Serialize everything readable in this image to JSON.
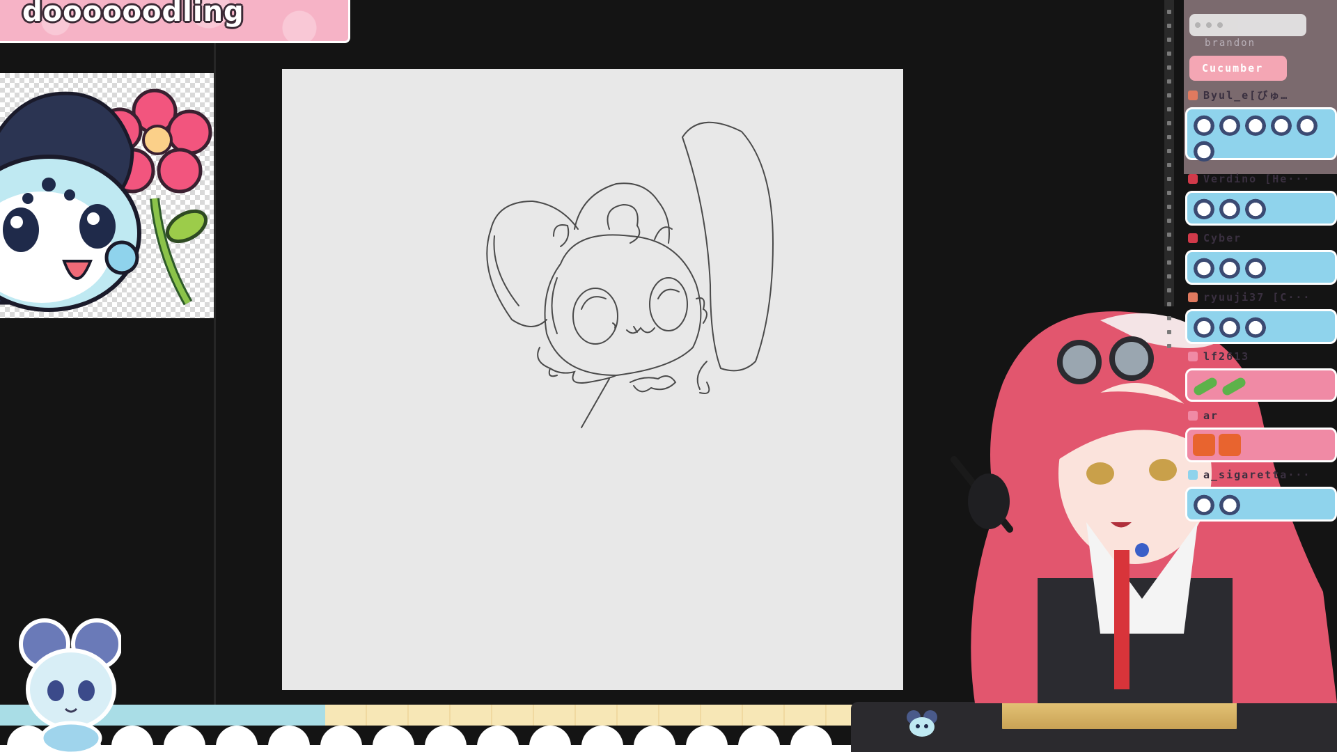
{
  "banner": {
    "title": "doooooodling"
  },
  "chat": {
    "top_username": "brandon",
    "top_pill": "Cucumber",
    "messages": [
      {
        "username": "Byul_e[びゅ…",
        "badge_color": "#e07a5f",
        "style": "blue",
        "emotes": [
          "panda",
          "panda",
          "panda",
          "panda",
          "panda",
          "panda"
        ]
      },
      {
        "username": "Verdino [He···",
        "badge_color": "#d13a4a",
        "style": "blue",
        "emotes": [
          "panda",
          "panda",
          "panda"
        ]
      },
      {
        "username": "Cyber",
        "badge_color": "#d13a4a",
        "style": "blue",
        "emotes": [
          "panda",
          "panda",
          "panda"
        ]
      },
      {
        "username": "ryuuji37 [C···",
        "badge_color": "#e07a5f",
        "style": "blue",
        "emotes": [
          "panda",
          "panda",
          "panda"
        ]
      },
      {
        "username": "lf2613",
        "badge_color": "#f08aa5",
        "style": "pink",
        "emotes": [
          "cucumber",
          "cucumber"
        ]
      },
      {
        "username": "ar",
        "badge_color": "#f08aa5",
        "style": "pink",
        "emotes": [
          "fox",
          "fox"
        ]
      },
      {
        "username": "a_sigaretta···",
        "badge_color": "#8fd3ec",
        "style": "blue",
        "emotes": [
          "panda",
          "panda"
        ]
      }
    ]
  },
  "colors": {
    "background": "#141414",
    "banner_pink": "#f6b3c6",
    "canvas": "#e8e8e8",
    "chat_blue": "#8fd3ec",
    "chat_pink": "#f08aa5",
    "strip_blue": "#a9dde6",
    "strip_yellow": "#f7e7b6",
    "desk_gold": "#e8c97c"
  },
  "icons": {
    "reference_image": "panda-mascot-with-flower",
    "mascot": "chibi-mouse-mascot",
    "desk_icon": "mouse-head-icon",
    "streamer": "vtuber-avatar"
  }
}
